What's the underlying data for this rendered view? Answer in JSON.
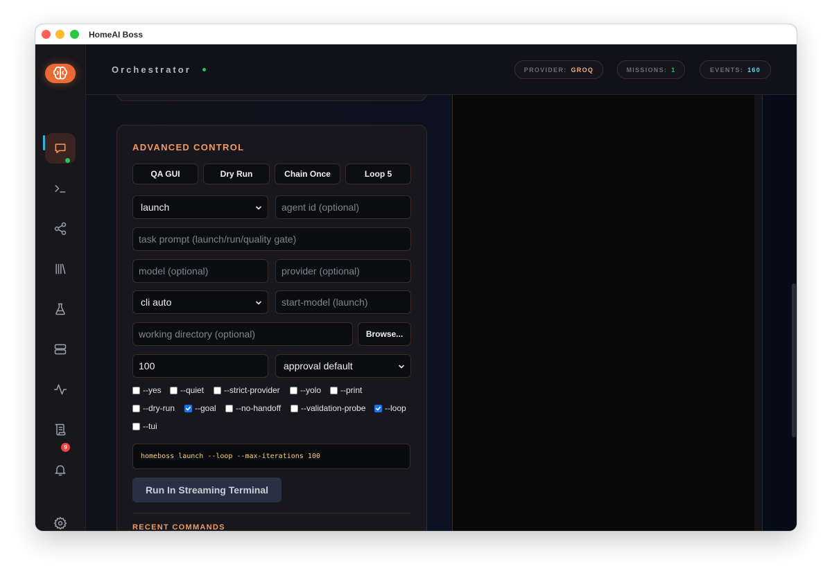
{
  "window": {
    "title": "HomeAI Boss"
  },
  "header": {
    "title": "Orchestrator",
    "pills": [
      {
        "label": "PROVIDER:",
        "value": "GROQ",
        "color": "#f3b486"
      },
      {
        "label": "MISSIONS:",
        "value": "1",
        "color": "#22c55e"
      },
      {
        "label": "EVENTS:",
        "value": "160",
        "color": "#67d6f5"
      }
    ]
  },
  "sidebar": {
    "items": [
      {
        "icon": "chat-icon",
        "active": true
      },
      {
        "icon": "terminal-icon",
        "status": "online"
      },
      {
        "icon": "share-icon"
      },
      {
        "icon": "library-icon"
      },
      {
        "icon": "flask-icon"
      },
      {
        "icon": "server-icon"
      },
      {
        "icon": "activity-icon"
      },
      {
        "icon": "scroll-icon"
      },
      {
        "icon": "bell-icon",
        "badge": "9"
      },
      {
        "icon": "gear-icon"
      }
    ]
  },
  "advanced": {
    "title": "ADVANCED CONTROL",
    "buttons": [
      "QA GUI",
      "Dry Run",
      "Chain Once",
      "Loop 5"
    ],
    "action_select": "launch",
    "agent_id_placeholder": "agent id (optional)",
    "task_prompt_placeholder": "task prompt (launch/run/quality gate)",
    "model_placeholder": "model (optional)",
    "provider_placeholder": "provider (optional)",
    "cli_select": "cli auto",
    "start_model_placeholder": "start-model (launch)",
    "workdir_placeholder": "working directory (optional)",
    "browse_label": "Browse...",
    "max_iterations": "100",
    "approval_select": "approval default",
    "flags": [
      {
        "label": "--yes",
        "checked": false
      },
      {
        "label": "--quiet",
        "checked": false
      },
      {
        "label": "--strict-provider",
        "checked": false
      },
      {
        "label": "--yolo",
        "checked": false
      },
      {
        "label": "--print",
        "checked": false
      },
      {
        "label": "--dry-run",
        "checked": false
      },
      {
        "label": "--goal",
        "checked": true
      },
      {
        "label": "--no-handoff",
        "checked": false
      },
      {
        "label": "--validation-probe",
        "checked": false
      },
      {
        "label": "--loop",
        "checked": true
      },
      {
        "label": "--tui",
        "checked": false
      }
    ],
    "command_preview": "homeboss launch --loop --max-iterations 100",
    "run_label": "Run In Streaming Terminal",
    "recent_title": "RECENT COMMANDS"
  }
}
